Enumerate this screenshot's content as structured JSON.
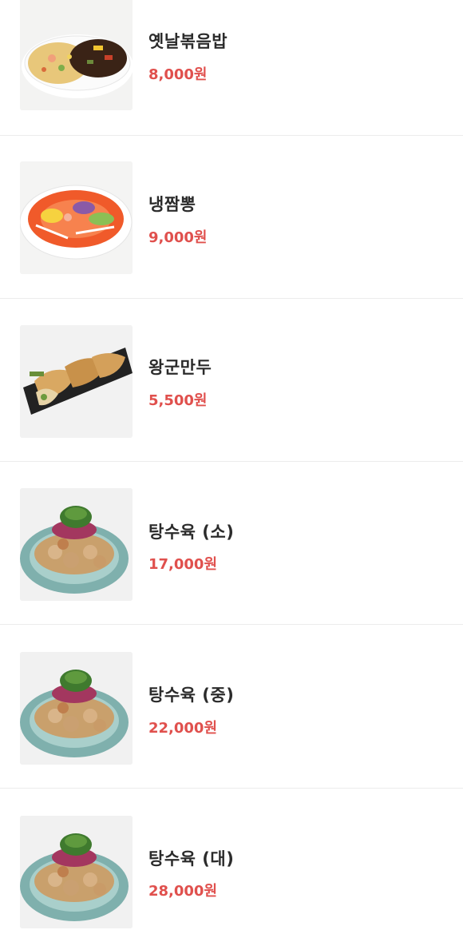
{
  "menu": {
    "items": [
      {
        "name": "옛날볶음밥",
        "price": "8,000원",
        "image_icon": "fried-rice-image"
      },
      {
        "name": "냉짬뽕",
        "price": "9,000원",
        "image_icon": "cold-jjamppong-image"
      },
      {
        "name": "왕군만두",
        "price": "5,500원",
        "image_icon": "fried-dumplings-image"
      },
      {
        "name": "탕수육 (소)",
        "price": "17,000원",
        "image_icon": "sweet-sour-pork-image"
      },
      {
        "name": "탕수육 (중)",
        "price": "22,000원",
        "image_icon": "sweet-sour-pork-image"
      },
      {
        "name": "탕수육 (대)",
        "price": "28,000원",
        "image_icon": "sweet-sour-pork-image"
      }
    ]
  },
  "colors": {
    "price": "#e0504d",
    "name": "#2b2b2b",
    "divider": "#ececec"
  }
}
